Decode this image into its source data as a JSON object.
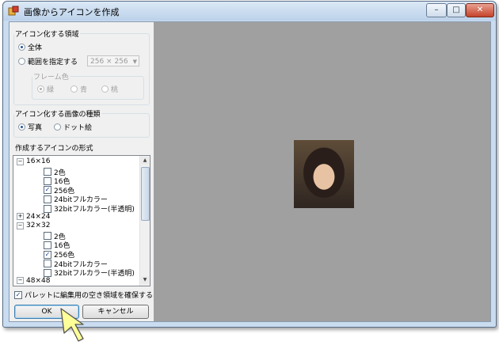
{
  "window": {
    "title": "画像からアイコンを作成",
    "buttons": {
      "minimize": "–",
      "maximize": "□",
      "close": "✕"
    }
  },
  "area": {
    "legend": "アイコン化する領域",
    "options": [
      {
        "label": "全体",
        "checked": true
      },
      {
        "label": "範囲を指定する",
        "checked": false
      }
    ],
    "size_value": "256 × 256",
    "frame": {
      "legend": "フレーム色",
      "colors": [
        {
          "label": "緑",
          "checked": true
        },
        {
          "label": "青",
          "checked": false
        },
        {
          "label": "桃",
          "checked": false
        }
      ]
    }
  },
  "kind": {
    "legend": "アイコン化する画像の種類",
    "options": [
      {
        "label": "写真",
        "checked": true
      },
      {
        "label": "ドット絵",
        "checked": false
      }
    ]
  },
  "formats": {
    "label": "作成するアイコンの形式",
    "tree": [
      {
        "text": "16×16",
        "level": 0,
        "toggle": "−"
      },
      {
        "text": "2色",
        "level": 1,
        "checked": false
      },
      {
        "text": "16色",
        "level": 1,
        "checked": false
      },
      {
        "text": "256色",
        "level": 1,
        "checked": true
      },
      {
        "text": "24bitフルカラー",
        "level": 1,
        "checked": false
      },
      {
        "text": "32bitフルカラー(半透明)",
        "level": 1,
        "checked": false
      },
      {
        "text": "24×24",
        "level": 0,
        "toggle": "+"
      },
      {
        "text": "32×32",
        "level": 0,
        "toggle": "−"
      },
      {
        "text": "2色",
        "level": 1,
        "checked": false
      },
      {
        "text": "16色",
        "level": 1,
        "checked": false
      },
      {
        "text": "256色",
        "level": 1,
        "checked": true
      },
      {
        "text": "24bitフルカラー",
        "level": 1,
        "checked": false
      },
      {
        "text": "32bitフルカラー(半透明)",
        "level": 1,
        "checked": false
      },
      {
        "text": "48×48",
        "level": 0,
        "toggle": "−"
      }
    ]
  },
  "palette_option": {
    "label": "パレットに編集用の空き領域を確保する",
    "checked": true
  },
  "buttons": {
    "ok": "OK",
    "cancel": "キャンセル"
  },
  "colors": {
    "preview_bg": "#a0a0a0",
    "window_frame": "#c9dcf0"
  }
}
